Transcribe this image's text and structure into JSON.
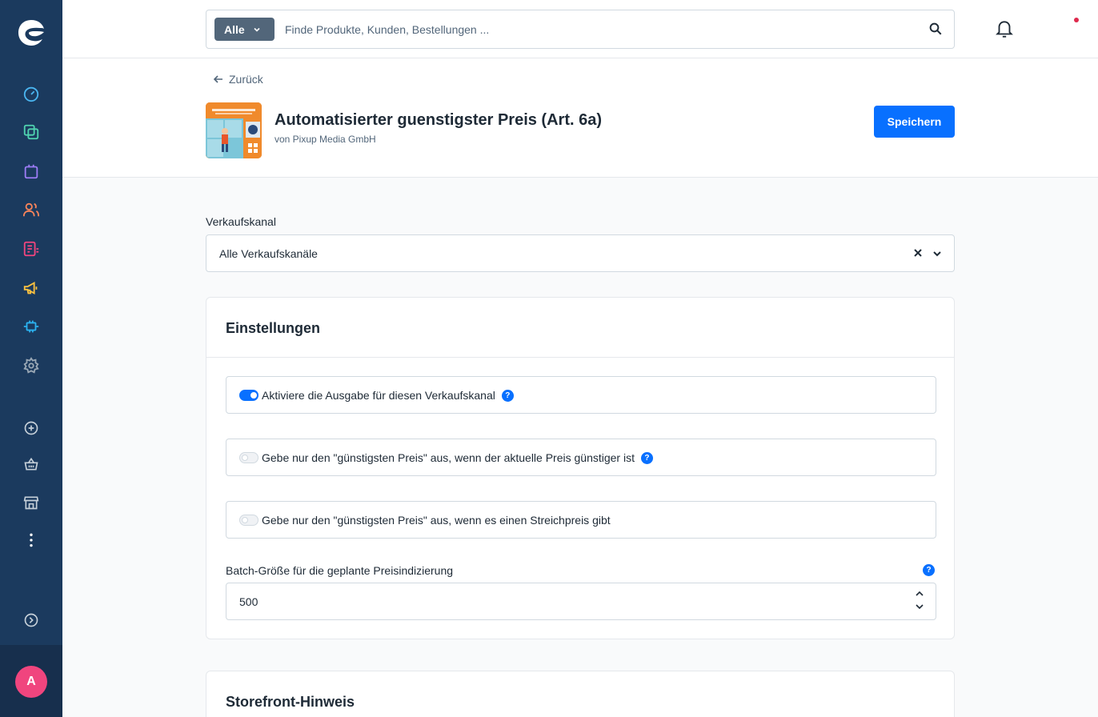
{
  "colors": {
    "sidebar": "#1b3a5e",
    "primary": "#0870ff",
    "avatar": "#f0457e"
  },
  "sidebar": {
    "items": [
      {
        "icon": "dashboard-icon",
        "color": "#4ab5f0"
      },
      {
        "icon": "catalog-icon",
        "color": "#4fd3b0"
      },
      {
        "icon": "orders-icon",
        "color": "#9c7cf5"
      },
      {
        "icon": "customers-icon",
        "color": "#f8845a"
      },
      {
        "icon": "content-icon",
        "color": "#f0457e"
      },
      {
        "icon": "marketing-icon",
        "color": "#ffc240"
      },
      {
        "icon": "extensions-icon",
        "color": "#2bb2f0"
      },
      {
        "icon": "settings-icon",
        "color": "#9aa8b5"
      }
    ],
    "secondary": [
      "add-icon",
      "basket-icon",
      "store-icon",
      "more-icon",
      "expand-icon"
    ],
    "avatar_initial": "A"
  },
  "search": {
    "type_label": "Alle",
    "placeholder": "Finde Produkte, Kunden, Bestellungen ..."
  },
  "header": {
    "back_label": "Zurück",
    "title": "Automatisierter guenstigster Preis (Art. 6a)",
    "vendor": "von Pixup Media GmbH",
    "save_label": "Speichern"
  },
  "sales_channel": {
    "label": "Verkaufskanal",
    "value": "Alle Verkaufskanäle"
  },
  "settings_card": {
    "title": "Einstellungen",
    "switches": [
      {
        "label": "Aktiviere die Ausgabe für diesen Verkaufskanal",
        "checked": true,
        "help": true
      },
      {
        "label": "Gebe nur den \"günstigsten Preis\" aus, wenn der aktuelle Preis günstiger ist",
        "checked": false,
        "help": true
      },
      {
        "label": "Gebe nur den \"günstigsten Preis\" aus, wenn es einen Streichpreis gibt",
        "checked": false,
        "help": false
      }
    ],
    "batch_label": "Batch-Größe für die geplante Preisindizierung",
    "batch_value": "500"
  },
  "storefront_card": {
    "title": "Storefront-Hinweis"
  }
}
